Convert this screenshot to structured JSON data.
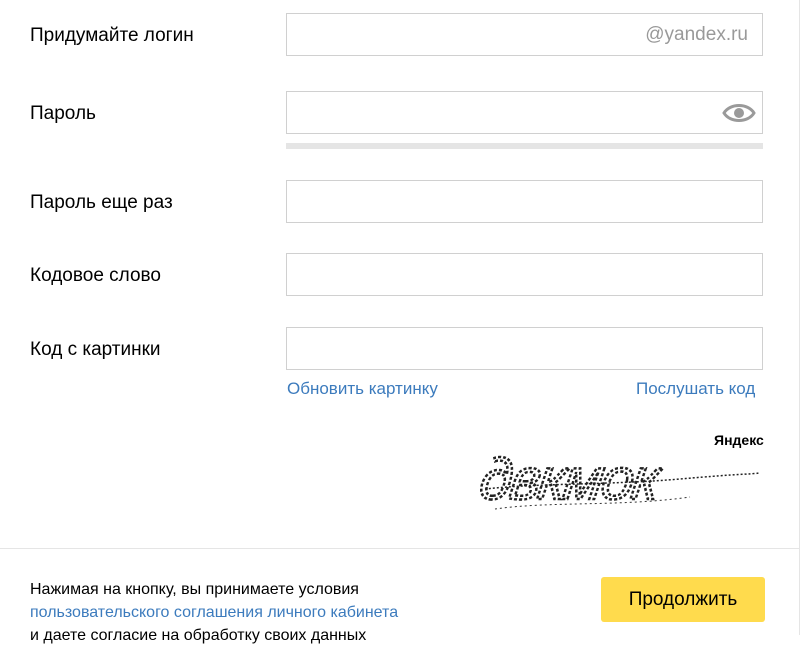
{
  "form": {
    "login": {
      "label": "Придумайте логин",
      "value": "",
      "suffix": "@yandex.ru"
    },
    "password": {
      "label": "Пароль",
      "value": ""
    },
    "password_repeat": {
      "label": "Пароль еще раз",
      "value": ""
    },
    "code_word": {
      "label": "Кодовое слово",
      "value": ""
    },
    "captcha": {
      "label": "Код с картинки",
      "value": "",
      "refresh_link": "Обновить картинку",
      "listen_link": "Послушать код",
      "image_brand": "Яндекс",
      "image_text": "двкмок"
    }
  },
  "footer": {
    "terms_line1": "Нажимая на кнопку, вы принимаете условия",
    "terms_link": "пользовательского соглашения личного кабинета",
    "terms_line3": "и даете согласие на обработку своих данных",
    "continue_button": "Продолжить"
  },
  "colors": {
    "accent_button": "#ffdb4d",
    "link": "#3c7bbd",
    "border": "#d0d0d0"
  },
  "icons": {
    "password_visibility": "eye-icon"
  }
}
